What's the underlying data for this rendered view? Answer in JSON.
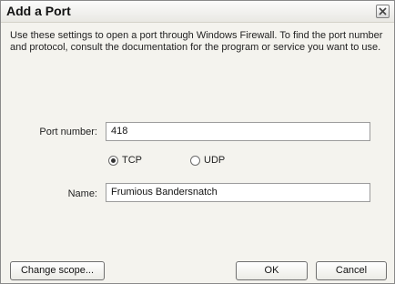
{
  "dialog": {
    "title": "Add a Port",
    "description": "Use these settings to open a port through Windows Firewall. To find the port number and protocol, consult the documentation for the program or service you want to use."
  },
  "form": {
    "port_label": "Port number:",
    "port_value": "418",
    "protocol_options": [
      {
        "label": "TCP",
        "selected": true
      },
      {
        "label": "UDP",
        "selected": false
      }
    ],
    "name_label": "Name:",
    "name_value": "Frumious Bandersnatch"
  },
  "buttons": {
    "change_scope": "Change scope...",
    "ok": "OK",
    "cancel": "Cancel"
  },
  "icons": {
    "close": "close-icon"
  }
}
